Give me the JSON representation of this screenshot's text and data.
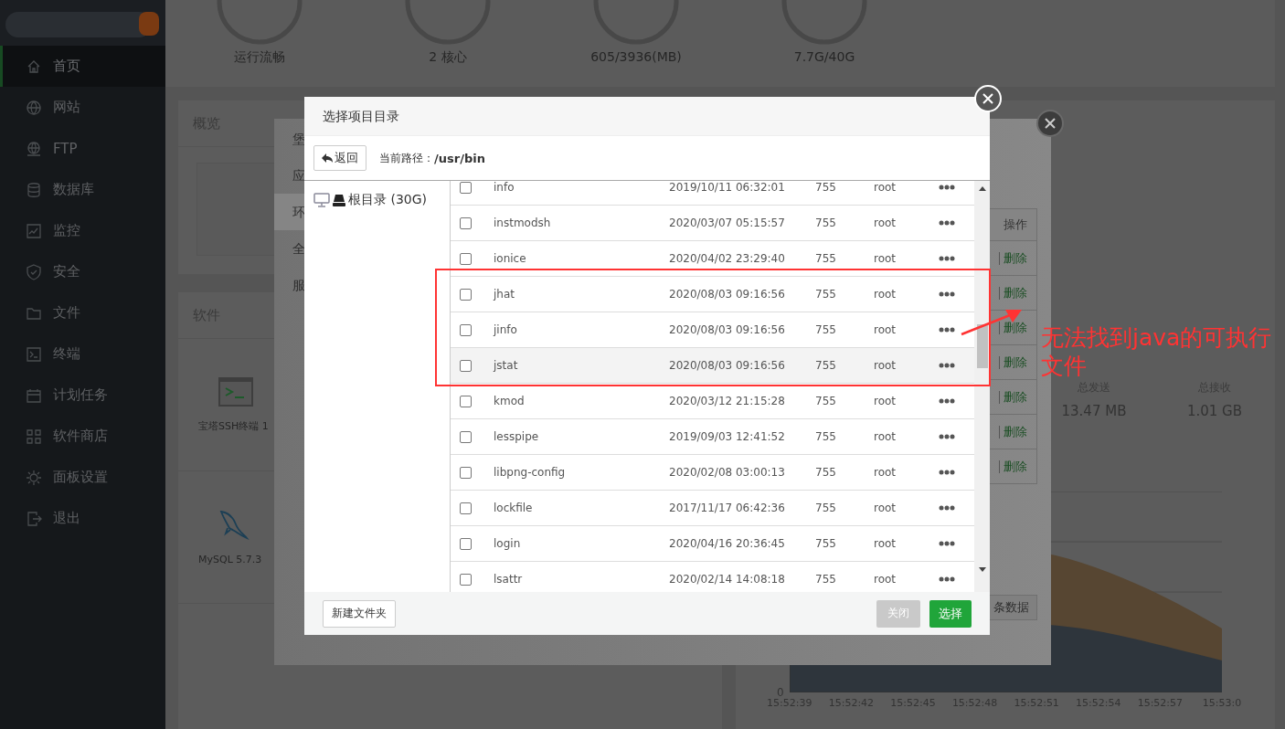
{
  "sidebar": {
    "items": [
      {
        "label": "首页",
        "selected": true
      },
      {
        "label": "网站",
        "selected": false
      },
      {
        "label": "FTP",
        "selected": false
      },
      {
        "label": "数据库",
        "selected": false
      },
      {
        "label": "监控",
        "selected": false
      },
      {
        "label": "安全",
        "selected": false
      },
      {
        "label": "文件",
        "selected": false
      },
      {
        "label": "终端",
        "selected": false
      },
      {
        "label": "计划任务",
        "selected": false
      },
      {
        "label": "软件商店",
        "selected": false
      },
      {
        "label": "面板设置",
        "selected": false
      },
      {
        "label": "退出",
        "selected": false
      }
    ]
  },
  "stats": [
    "运行流畅",
    "2 核心",
    "605/3936(MB)",
    "7.7G/40G"
  ],
  "overview": {
    "title": "概览"
  },
  "software": {
    "title": "软件",
    "items": [
      {
        "name": "宝塔SSH终端 1",
        "kind": "terminal"
      },
      {
        "name": "MySQL 5.7.3",
        "kind": "mysql"
      }
    ]
  },
  "traffic": [
    {
      "label": "总发送",
      "value": "13.47 MB"
    },
    {
      "label": "总接收",
      "value": "1.01 GB"
    }
  ],
  "chart": {
    "ytick": "0",
    "xticks": [
      "15:52:39",
      "15:52:42",
      "15:52:45",
      "15:52:48",
      "15:52:51",
      "15:52:54",
      "15:52:57",
      "15:53:0"
    ]
  },
  "settings_dialog": {
    "tabs": [
      {
        "label": "堡",
        "selected": false
      },
      {
        "label": "应",
        "selected": false
      },
      {
        "label": "环",
        "selected": true
      },
      {
        "label": "全",
        "selected": false
      },
      {
        "label": "服",
        "selected": false
      }
    ],
    "table": {
      "header": "操作",
      "rows": [
        {
          "delete": "删除"
        },
        {
          "delete": "删除"
        },
        {
          "delete": "删除"
        },
        {
          "delete": "删除"
        },
        {
          "delete": "删除"
        },
        {
          "delete": "删除"
        },
        {
          "delete": "删除"
        }
      ]
    },
    "button": "条数据"
  },
  "dialog": {
    "title": "选择项目目录",
    "back": "返回",
    "path_label": "当前路径：",
    "path": "/usr/bin",
    "tree": {
      "label": "根目录 (30G)"
    },
    "files": [
      {
        "name": "info",
        "date": "2019/10/11 06:32:01",
        "perm": "755",
        "owner": "root",
        "checked": false,
        "hovered": false
      },
      {
        "name": "instmodsh",
        "date": "2020/03/07 05:15:57",
        "perm": "755",
        "owner": "root",
        "checked": false,
        "hovered": false
      },
      {
        "name": "ionice",
        "date": "2020/04/02 23:29:40",
        "perm": "755",
        "owner": "root",
        "checked": false,
        "hovered": false
      },
      {
        "name": "jhat",
        "date": "2020/08/03 09:16:56",
        "perm": "755",
        "owner": "root",
        "checked": false,
        "hovered": false
      },
      {
        "name": "jinfo",
        "date": "2020/08/03 09:16:56",
        "perm": "755",
        "owner": "root",
        "checked": false,
        "hovered": false
      },
      {
        "name": "jstat",
        "date": "2020/08/03 09:16:56",
        "perm": "755",
        "owner": "root",
        "checked": false,
        "hovered": true
      },
      {
        "name": "kmod",
        "date": "2020/03/12 21:15:28",
        "perm": "755",
        "owner": "root",
        "checked": false,
        "hovered": false
      },
      {
        "name": "lesspipe",
        "date": "2019/09/03 12:41:52",
        "perm": "755",
        "owner": "root",
        "checked": false,
        "hovered": false
      },
      {
        "name": "libpng-config",
        "date": "2020/02/08 03:00:13",
        "perm": "755",
        "owner": "root",
        "checked": false,
        "hovered": false
      },
      {
        "name": "lockfile",
        "date": "2017/11/17 06:42:36",
        "perm": "755",
        "owner": "root",
        "checked": false,
        "hovered": false
      },
      {
        "name": "login",
        "date": "2020/04/16 20:36:45",
        "perm": "755",
        "owner": "root",
        "checked": false,
        "hovered": false
      },
      {
        "name": "lsattr",
        "date": "2020/02/14 14:08:18",
        "perm": "755",
        "owner": "root",
        "checked": false,
        "hovered": false
      }
    ],
    "new_folder": "新建文件夹",
    "close": {
      "label": "关闭",
      "disabled": true
    },
    "select": "选择"
  },
  "annotation": {
    "text": "无法找到java的可执行文件"
  }
}
